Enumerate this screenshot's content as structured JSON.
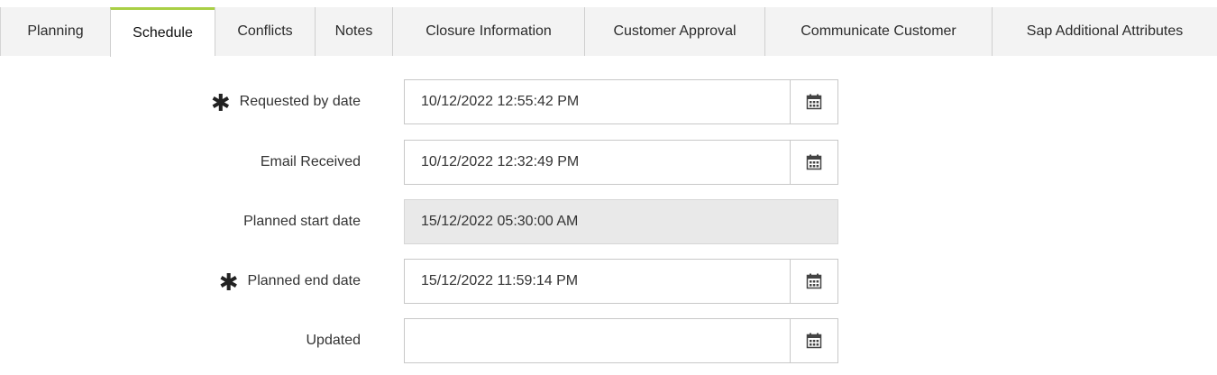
{
  "tabs": [
    {
      "label": "Planning",
      "active": false
    },
    {
      "label": "Schedule",
      "active": true
    },
    {
      "label": "Conflicts",
      "active": false
    },
    {
      "label": "Notes",
      "active": false
    },
    {
      "label": "Closure Information",
      "active": false
    },
    {
      "label": "Customer Approval",
      "active": false
    },
    {
      "label": "Communicate Customer",
      "active": false
    },
    {
      "label": "Sap Additional Attributes",
      "active": false
    }
  ],
  "required_marker": "✱",
  "fields": {
    "requested_by_date": {
      "label": "Requested by date",
      "required": true,
      "value": "10/12/2022 12:55:42 PM",
      "readonly": false
    },
    "email_received": {
      "label": "Email Received",
      "required": false,
      "value": "10/12/2022 12:32:49 PM",
      "readonly": false
    },
    "planned_start_date": {
      "label": "Planned start date",
      "required": false,
      "value": "15/12/2022 05:30:00 AM",
      "readonly": true
    },
    "planned_end_date": {
      "label": "Planned end date",
      "required": true,
      "value": "15/12/2022 11:59:14 PM",
      "readonly": false
    },
    "updated": {
      "label": "Updated",
      "required": false,
      "value": "",
      "readonly": false
    }
  },
  "icons": {
    "calendar": "calendar-icon",
    "required": "asterisk-icon"
  },
  "colors": {
    "active_tab_accent": "#a9cf45",
    "tabbar_bg": "#f3f3f3",
    "readonly_bg": "#e9e9e9",
    "border": "#c8c8c8"
  }
}
